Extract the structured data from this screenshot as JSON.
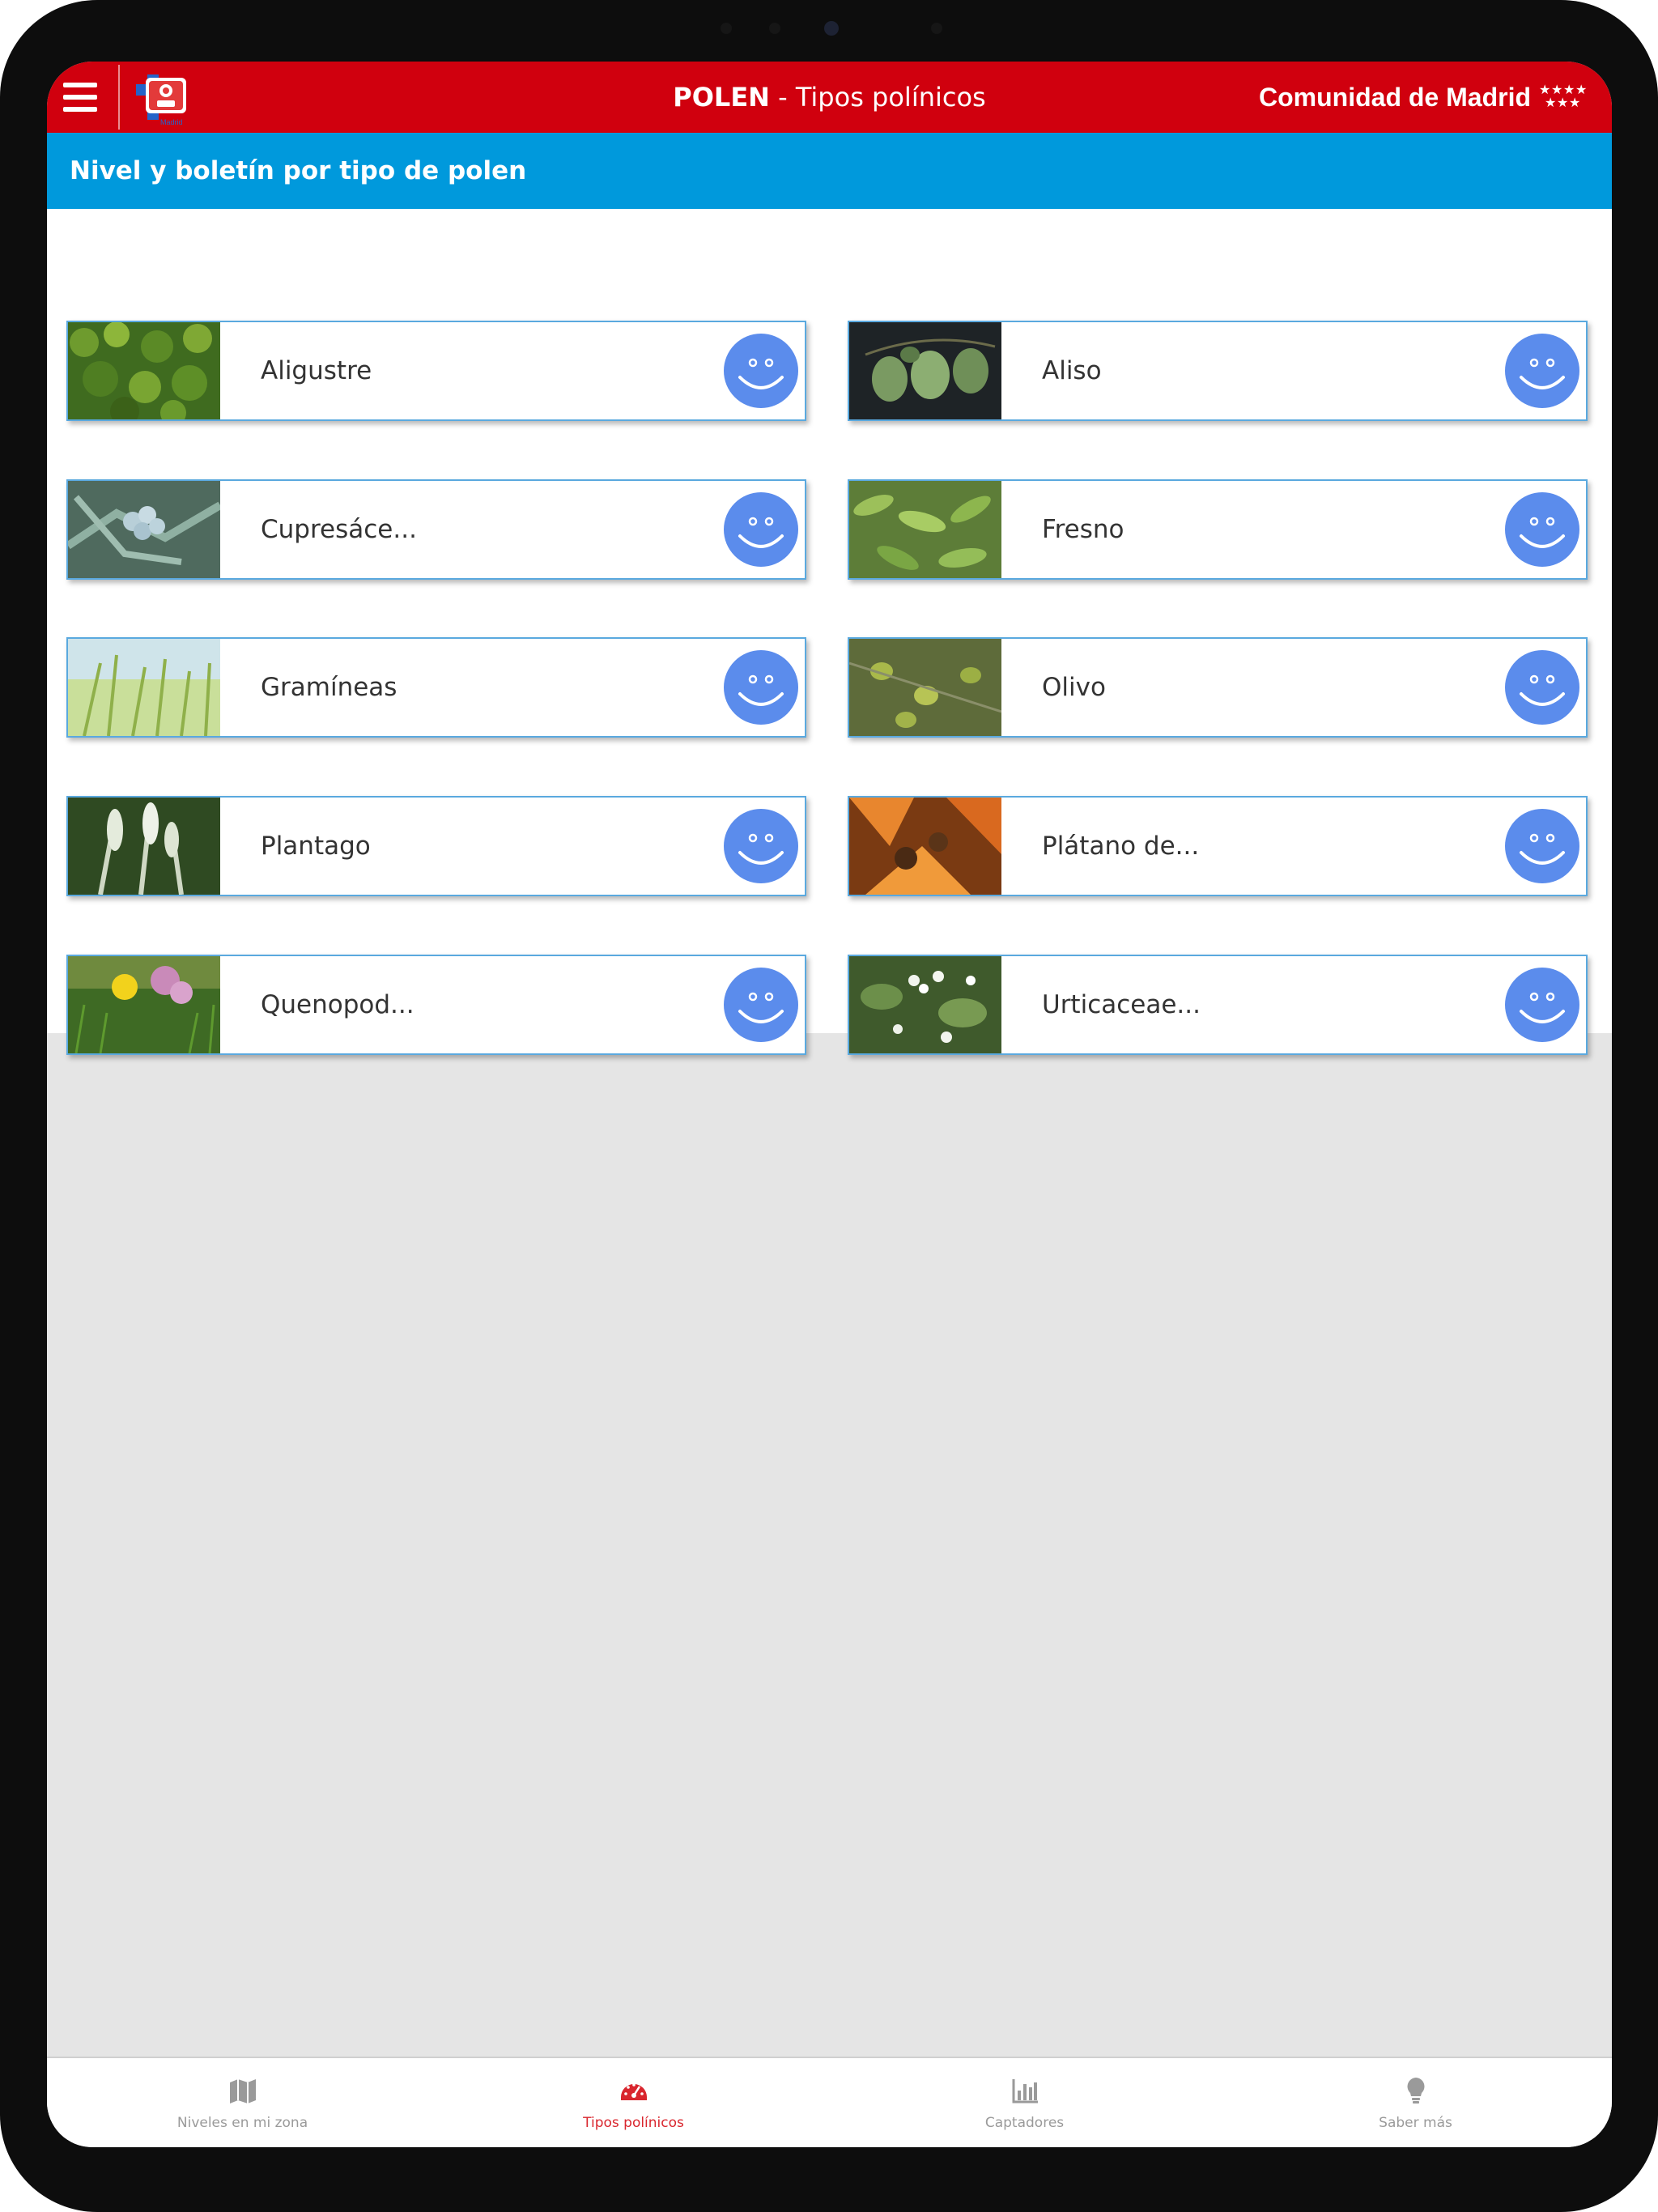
{
  "app_bar": {
    "title_bold": "POLEN",
    "title_rest": " - Tipos polínicos",
    "brand": "Comunidad de Madrid",
    "logo_caption": "Madrid"
  },
  "section": {
    "title": "Nivel y boletín por tipo de polen"
  },
  "pollen_types": [
    {
      "name": "Aligustre",
      "level_icon": "smiley-face-icon"
    },
    {
      "name": "Aliso",
      "level_icon": "smiley-face-icon"
    },
    {
      "name": "Cupresáce...",
      "level_icon": "smiley-face-icon"
    },
    {
      "name": "Fresno",
      "level_icon": "smiley-face-icon"
    },
    {
      "name": "Gramíneas",
      "level_icon": "smiley-face-icon"
    },
    {
      "name": "Olivo",
      "level_icon": "smiley-face-icon"
    },
    {
      "name": "Plantago",
      "level_icon": "smiley-face-icon"
    },
    {
      "name": "Plátano de...",
      "level_icon": "smiley-face-icon"
    },
    {
      "name": "Quenopod...",
      "level_icon": "smiley-face-icon"
    },
    {
      "name": "Urticaceae...",
      "level_icon": "smiley-face-icon"
    }
  ],
  "bottom_nav": [
    {
      "label": "Niveles en mi zona",
      "icon": "map-icon",
      "active": false
    },
    {
      "label": "Tipos polínicos",
      "icon": "gauge-icon",
      "active": true
    },
    {
      "label": "Captadores",
      "icon": "bar-chart-icon",
      "active": false
    },
    {
      "label": "Saber más",
      "icon": "lightbulb-icon",
      "active": false
    }
  ],
  "colors": {
    "app_bar": "#d0000e",
    "section_header": "#0099dc",
    "card_border": "#5aa9df",
    "smiley": "#5b8cec",
    "nav_active": "#d9262e",
    "nav_inactive": "#9a9a9a",
    "empty_area": "#e5e5e5"
  }
}
